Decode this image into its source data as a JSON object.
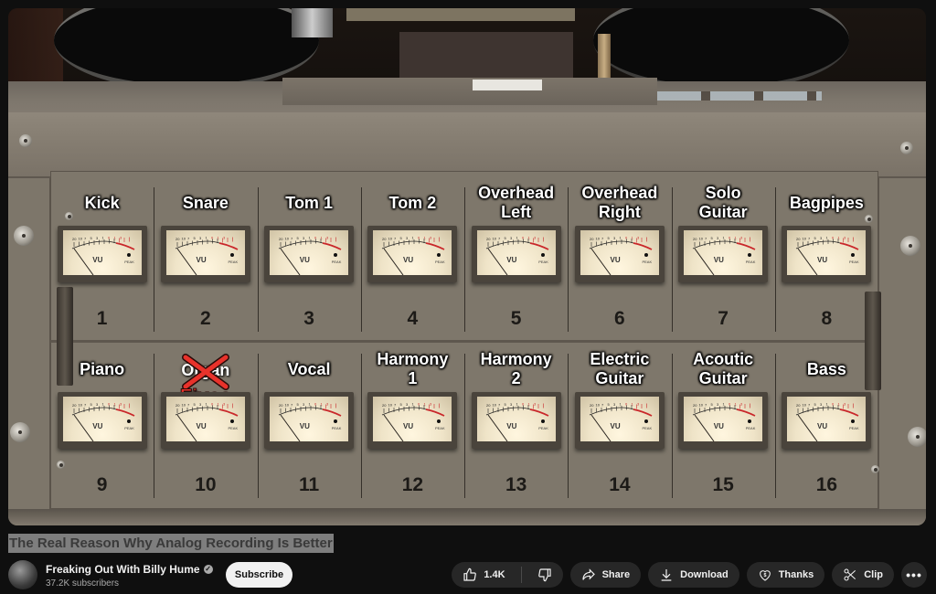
{
  "video": {
    "title": "The Real Reason Why Analog Recording Is Better",
    "scene": "Tape machine VU meter bridge with channel labels",
    "row_1": [
      {
        "label": "Kick",
        "number": "1"
      },
      {
        "label": "Snare",
        "number": "2"
      },
      {
        "label": "Tom 1",
        "number": "3"
      },
      {
        "label": "Tom 2",
        "number": "4"
      },
      {
        "label": "Overhead\nLeft",
        "number": "5"
      },
      {
        "label": "Overhead\nRight",
        "number": "6"
      },
      {
        "label": "Solo\nGuitar",
        "number": "7"
      },
      {
        "label": "Bagpipes",
        "number": "8"
      }
    ],
    "row_2": [
      {
        "label": "Piano",
        "number": "9"
      },
      {
        "label": "Organ",
        "struck": true,
        "replacement": "Fixes",
        "number": "10"
      },
      {
        "label": "Vocal",
        "number": "11"
      },
      {
        "label": "Harmony\n1",
        "number": "12"
      },
      {
        "label": "Harmony\n2",
        "number": "13"
      },
      {
        "label": "Electric\nGuitar",
        "number": "14"
      },
      {
        "label": "Acoutic\nGuitar",
        "number": "15"
      },
      {
        "label": "Bass",
        "number": "16"
      }
    ],
    "meter": {
      "scale_label": "VU",
      "peak_label": "PEAK",
      "scale_marks": [
        "20",
        "10",
        "7",
        "5",
        "3",
        "1",
        "0",
        "1",
        "3"
      ]
    }
  },
  "owner": {
    "channel_name": "Freaking Out With Billy Hume",
    "verified_icon": "verified-check-icon",
    "subscribers": "37.2K subscribers",
    "subscribe_label": "Subscribe"
  },
  "actions": {
    "like_count": "1.4K",
    "like_icon": "thumbs-up-icon",
    "dislike_icon": "thumbs-down-icon",
    "share_label": "Share",
    "share_icon": "share-arrow-icon",
    "download_label": "Download",
    "download_icon": "download-icon",
    "thanks_label": "Thanks",
    "thanks_icon": "super-thanks-heart-icon",
    "clip_label": "Clip",
    "clip_icon": "scissors-icon",
    "more_label": "•••"
  },
  "colors": {
    "page_bg": "#0f0f0f",
    "pill_bg": "#272727",
    "accent_red": "#e8322b",
    "meter_needle_red": "#c9272a"
  }
}
